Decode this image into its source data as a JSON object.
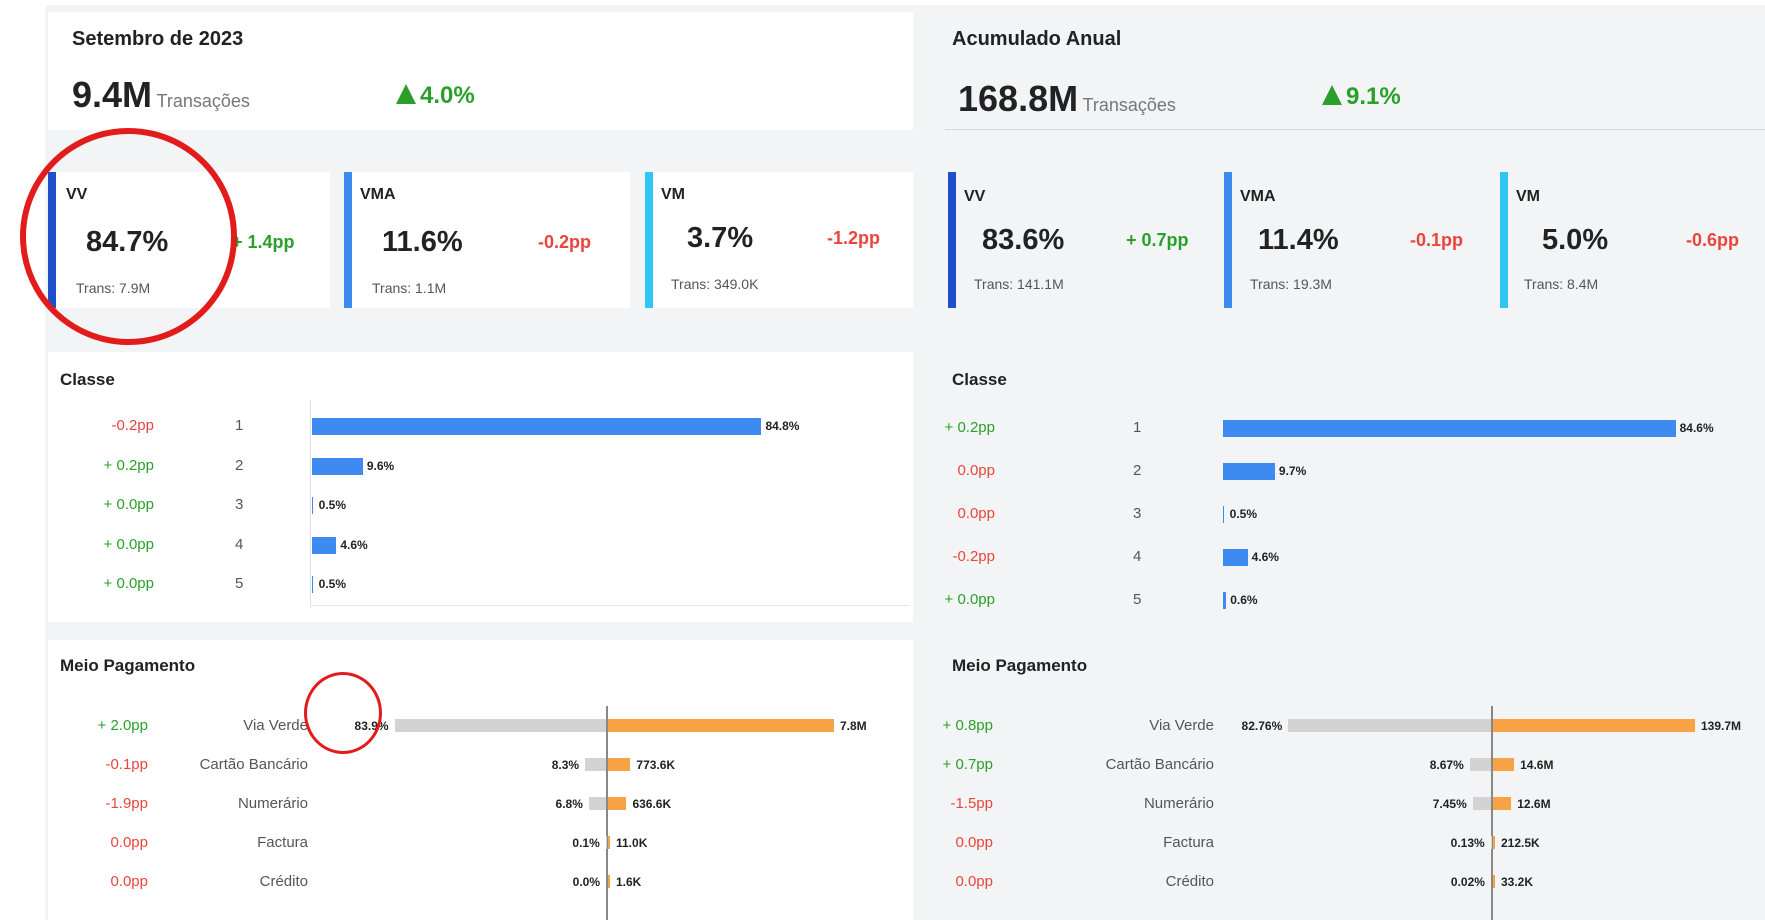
{
  "monthly": {
    "title": "Setembro de 2023",
    "total_value": "9.4M",
    "total_unit": "Transações",
    "total_delta": "4.0%",
    "cards": [
      {
        "name": "VV",
        "value": "84.7%",
        "delta": "+ 1.4pp",
        "trans": "Trans: 7.9M",
        "color": "#1f4fc9"
      },
      {
        "name": "VMA",
        "value": "11.6%",
        "delta": "-0.2pp",
        "trans": "Trans: 1.1M",
        "color": "#3d8bf0"
      },
      {
        "name": "VM",
        "value": "3.7%",
        "delta": "-1.2pp",
        "trans": "Trans: 349.0K",
        "color": "#2fc5f5"
      }
    ],
    "classe": {
      "title": "Classe",
      "rows": [
        {
          "delta": "-0.2pp",
          "label": "1",
          "value": 84.8,
          "text": "84.8%"
        },
        {
          "delta": "+ 0.2pp",
          "label": "2",
          "value": 9.6,
          "text": "9.6%"
        },
        {
          "delta": "+ 0.0pp",
          "label": "3",
          "value": 0.5,
          "text": "0.5%"
        },
        {
          "delta": "+ 0.0pp",
          "label": "4",
          "value": 4.6,
          "text": "4.6%"
        },
        {
          "delta": "+ 0.0pp",
          "label": "5",
          "value": 0.5,
          "text": "0.5%"
        }
      ]
    },
    "meio": {
      "title": "Meio Pagamento",
      "rows": [
        {
          "delta": "+ 2.0pp",
          "label": "Via Verde",
          "pct": 83.9,
          "pct_text": "83.9%",
          "abs": 7.8,
          "abs_text": "7.8M"
        },
        {
          "delta": "-0.1pp",
          "label": "Cartão Bancário",
          "pct": 8.3,
          "pct_text": "8.3%",
          "abs": 0.7736,
          "abs_text": "773.6K"
        },
        {
          "delta": "-1.9pp",
          "label": "Numerário",
          "pct": 6.8,
          "pct_text": "6.8%",
          "abs": 0.6366,
          "abs_text": "636.6K"
        },
        {
          "delta": "0.0pp",
          "label": "Factura",
          "pct": 0.1,
          "pct_text": "0.1%",
          "abs": 0.011,
          "abs_text": "11.0K"
        },
        {
          "delta": "0.0pp",
          "label": "Crédito",
          "pct": 0.0,
          "pct_text": "0.0%",
          "abs": 0.0016,
          "abs_text": "1.6K"
        }
      ]
    }
  },
  "annual": {
    "title": "Acumulado Anual",
    "total_value": "168.8M",
    "total_unit": "Transações",
    "total_delta": "9.1%",
    "cards": [
      {
        "name": "VV",
        "value": "83.6%",
        "delta": "+ 0.7pp",
        "trans": "Trans: 141.1M",
        "color": "#1f4fc9"
      },
      {
        "name": "VMA",
        "value": "11.4%",
        "delta": "-0.1pp",
        "trans": "Trans: 19.3M",
        "color": "#3d8bf0"
      },
      {
        "name": "VM",
        "value": "5.0%",
        "delta": "-0.6pp",
        "trans": "Trans: 8.4M",
        "color": "#2fc5f5"
      }
    ],
    "classe": {
      "title": "Classe",
      "rows": [
        {
          "delta": "+ 0.2pp",
          "label": "1",
          "value": 84.6,
          "text": "84.6%"
        },
        {
          "delta": "0.0pp",
          "label": "2",
          "value": 9.7,
          "text": "9.7%"
        },
        {
          "delta": "0.0pp",
          "label": "3",
          "value": 0.5,
          "text": "0.5%"
        },
        {
          "delta": "-0.2pp",
          "label": "4",
          "value": 4.6,
          "text": "4.6%"
        },
        {
          "delta": "+ 0.0pp",
          "label": "5",
          "value": 0.6,
          "text": "0.6%"
        }
      ]
    },
    "meio": {
      "title": "Meio Pagamento",
      "rows": [
        {
          "delta": "+ 0.8pp",
          "label": "Via Verde",
          "pct": 82.76,
          "pct_text": "82.76%",
          "abs": 139.7,
          "abs_text": "139.7M"
        },
        {
          "delta": "+ 0.7pp",
          "label": "Cartão Bancário",
          "pct": 8.67,
          "pct_text": "8.67%",
          "abs": 14.6,
          "abs_text": "14.6M"
        },
        {
          "delta": "-1.5pp",
          "label": "Numerário",
          "pct": 7.45,
          "pct_text": "7.45%",
          "abs": 12.6,
          "abs_text": "12.6M"
        },
        {
          "delta": "0.0pp",
          "label": "Factura",
          "pct": 0.13,
          "pct_text": "0.13%",
          "abs": 0.2125,
          "abs_text": "212.5K"
        },
        {
          "delta": "0.0pp",
          "label": "Crédito",
          "pct": 0.02,
          "pct_text": "0.02%",
          "abs": 0.0332,
          "abs_text": "33.2K"
        }
      ]
    }
  },
  "colors": {
    "positive": "#2aa02a",
    "negative": "#e8453c",
    "classe_bar": "#3d8bf0",
    "pay_pct_bar": "#d3d3d3",
    "pay_abs_bar": "#f7a244",
    "highlight_ring": "#e21b1b"
  }
}
